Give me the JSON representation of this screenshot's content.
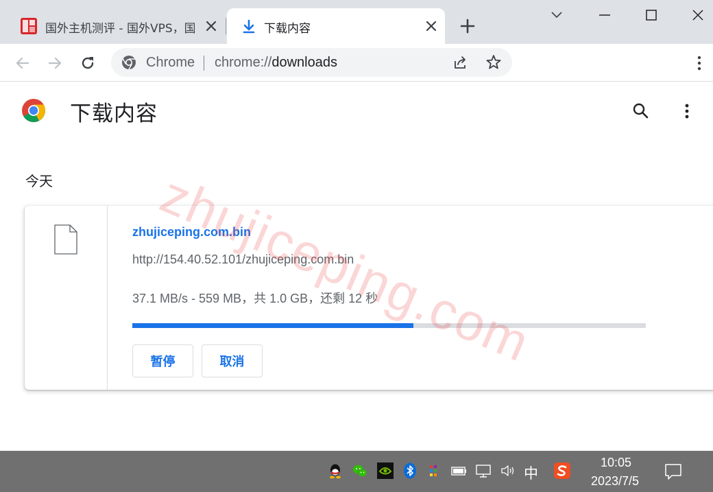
{
  "tabs": [
    {
      "title": "国外主机测评 - 国外VPS，国",
      "active": false
    },
    {
      "title": "下载内容",
      "active": true
    }
  ],
  "omnibox": {
    "site_label": "Chrome",
    "url_scheme": "chrome://",
    "url_host": "downloads"
  },
  "page": {
    "title": "下载内容",
    "date_group": "今天"
  },
  "download": {
    "file_name": "zhujiceping.com.bin",
    "url": "http://154.40.52.101/zhujiceping.com.bin",
    "status": "37.1 MB/s - 559 MB，共 1.0 GB，还剩 12 秒",
    "progress_fraction": 0.547,
    "pause_label": "暂停",
    "cancel_label": "取消"
  },
  "watermark": "zhujiceping.com",
  "taskbar": {
    "ime": "中",
    "time": "10:05",
    "date": "2023/7/5"
  },
  "colors": {
    "accent": "#1a73e8",
    "tabstrip": "#dee1e6",
    "taskbar": "#707070"
  },
  "icons": [
    "site-favicon",
    "download-icon",
    "close-icon",
    "new-tab-icon",
    "minimize-icon",
    "maximize-icon",
    "window-close-icon",
    "back-icon",
    "forward-icon",
    "reload-icon",
    "chrome-icon",
    "share-icon",
    "star-icon",
    "menu-icon",
    "chrome-logo-icon",
    "search-icon",
    "file-icon",
    "qq-icon",
    "wechat-icon",
    "nvidia-icon",
    "bluetooth-icon",
    "color-grid-icon",
    "battery-icon",
    "network-icon",
    "volume-icon",
    "sogou-icon",
    "notification-icon"
  ]
}
